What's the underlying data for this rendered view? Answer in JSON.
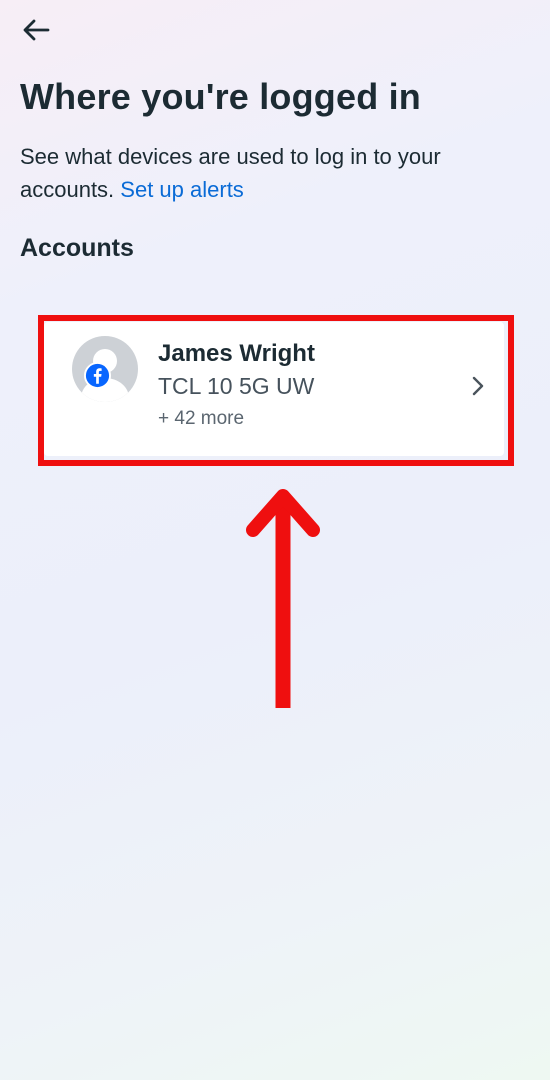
{
  "header": {
    "back_icon": "arrow-left-icon",
    "title": "Where you're logged in",
    "description": "See what devices are used to log in to your accounts.",
    "alerts_link": "Set up alerts"
  },
  "accounts": {
    "heading": "Accounts",
    "items": [
      {
        "name": "James Wright",
        "device": "TCL 10 5G UW",
        "more": "+ 42 more",
        "avatar_icon": "default-avatar-icon",
        "badge_icon": "facebook-icon",
        "chevron_icon": "chevron-right-icon"
      }
    ]
  },
  "annotation": {
    "highlight_color": "#ef0f0f",
    "arrow_icon": "arrow-up-icon"
  },
  "colors": {
    "link": "#0a6bd6",
    "facebook_blue": "#0866ff",
    "text_primary": "#1c2b33"
  }
}
